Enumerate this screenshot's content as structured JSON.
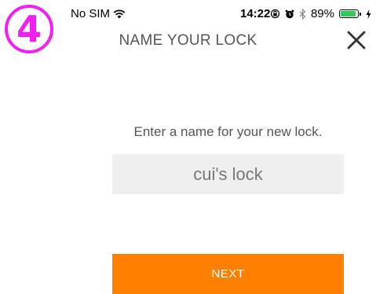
{
  "step_marker": {
    "label": "4",
    "color": "#f020f0"
  },
  "status_bar": {
    "carrier": "No SIM",
    "time": "14:22",
    "battery_percent": "89%",
    "battery_level": 0.89,
    "icons": [
      "wifi-icon",
      "orientation-lock-icon",
      "alarm-icon",
      "bluetooth-icon",
      "battery-icon",
      "charging-bolt-icon"
    ]
  },
  "header": {
    "title": "NAME YOUR LOCK",
    "close_icon": "close-icon"
  },
  "form": {
    "prompt": "Enter a name for your new lock.",
    "lock_name_value": "cui's lock"
  },
  "actions": {
    "next_label": "NEXT"
  },
  "colors": {
    "accent": "#ff8000",
    "field_background": "#efefef",
    "caret": "#4a7cf0",
    "battery": "#35c759"
  }
}
